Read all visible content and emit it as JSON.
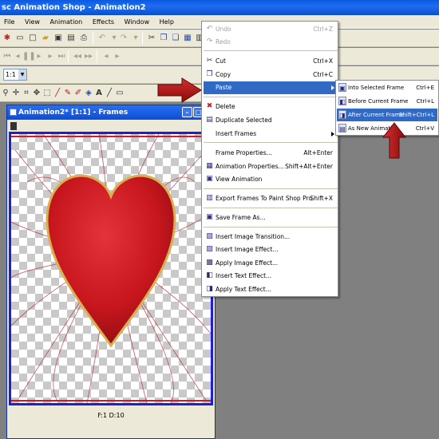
{
  "app": {
    "title": "sc Animation Shop - Animation2"
  },
  "menubar": [
    "File",
    "View",
    "Animation",
    "Effects",
    "Window",
    "Help"
  ],
  "toolbar": {
    "zoom_value": "1:1"
  },
  "document": {
    "title": "Animation2* [1:1] - Frames",
    "status": "F:1  D:10"
  },
  "edit_menu": {
    "items": [
      {
        "label": "Undo",
        "shortcut": "Ctrl+Z",
        "icon": "undo-icon",
        "disabled": true
      },
      {
        "label": "Redo",
        "shortcut": "",
        "icon": "redo-icon",
        "disabled": true
      },
      {
        "label": "Cut",
        "shortcut": "Ctrl+X",
        "icon": "scissors-icon",
        "disabled": false
      },
      {
        "label": "Copy",
        "shortcut": "Ctrl+C",
        "icon": "copy-icon",
        "disabled": false
      },
      {
        "label": "Paste",
        "shortcut": "",
        "icon": "",
        "disabled": false,
        "submenu": true,
        "highlighted": true
      },
      {
        "label": "Delete",
        "shortcut": "",
        "icon": "delete-icon",
        "disabled": false
      },
      {
        "label": "Duplicate Selected",
        "shortcut": "",
        "icon": "duplicate-icon",
        "disabled": false
      },
      {
        "label": "Insert Frames",
        "shortcut": "",
        "icon": "",
        "disabled": false,
        "submenu": true
      },
      {
        "label": "Frame Properties...",
        "shortcut": "Alt+Enter",
        "icon": "",
        "disabled": false
      },
      {
        "label": "Animation Properties...",
        "shortcut": "Shift+Alt+Enter",
        "icon": "animation-properties-icon",
        "disabled": false
      },
      {
        "label": "View Animation",
        "shortcut": "",
        "icon": "view-animation-icon",
        "disabled": false
      },
      {
        "label": "Export Frames To Paint Shop Pro",
        "shortcut": "Shift+X",
        "icon": "export-icon",
        "disabled": false
      },
      {
        "label": "Save Frame As...",
        "shortcut": "",
        "icon": "save-frame-icon",
        "disabled": false
      },
      {
        "label": "Insert Image Transition...",
        "shortcut": "",
        "icon": "transition-icon",
        "disabled": false
      },
      {
        "label": "Insert Image Effect...",
        "shortcut": "",
        "icon": "image-effect-icon",
        "disabled": false
      },
      {
        "label": "Apply Image Effect...",
        "shortcut": "",
        "icon": "apply-effect-icon",
        "disabled": false
      },
      {
        "label": "Insert Text Effect...",
        "shortcut": "",
        "icon": "text-effect-icon",
        "disabled": false
      },
      {
        "label": "Apply Text Effect...",
        "shortcut": "",
        "icon": "apply-text-icon",
        "disabled": false
      }
    ]
  },
  "paste_submenu": {
    "items": [
      {
        "label": "Into Selected Frame",
        "shortcut": "Ctrl+E",
        "icon": "into-frame-icon"
      },
      {
        "label": "Before Current Frame",
        "shortcut": "Ctrl+L",
        "icon": "before-frame-icon"
      },
      {
        "label": "After Current Frame",
        "shortcut": "Shift+Ctrl+L",
        "icon": "after-frame-icon",
        "highlighted": true
      },
      {
        "label": "As New Animation",
        "shortcut": "Ctrl+V",
        "icon": "new-animation-icon"
      }
    ]
  },
  "colors": {
    "titlebar": "#0a5ae0",
    "highlight": "#316ac5",
    "heart": "#c8161e",
    "tutorial_arrow": "#b01010"
  }
}
